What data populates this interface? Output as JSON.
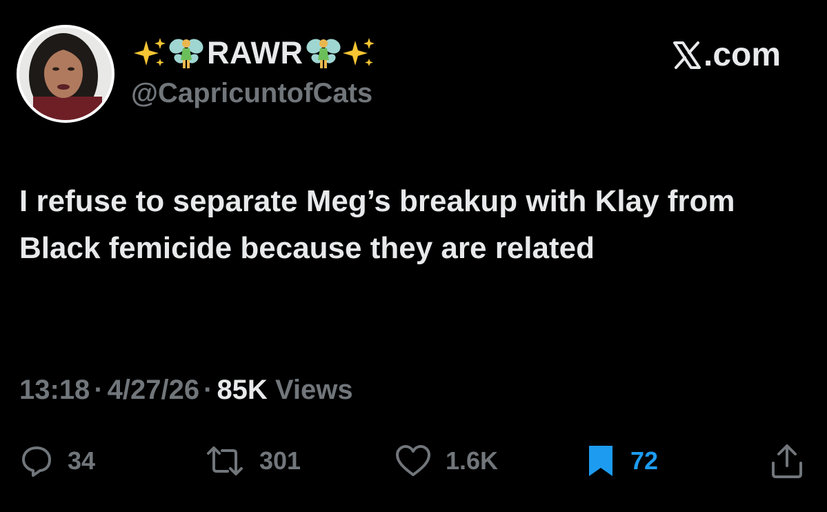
{
  "author": {
    "display_name": "RAWR",
    "handle": "@CapricuntofCats",
    "avatar_icon": "profile-photo",
    "name_emoji": [
      "sparkles-emoji",
      "fairy-emoji",
      "fairy-emoji",
      "sparkles-emoji"
    ]
  },
  "brand": {
    "label": ".com",
    "icon": "x-logo"
  },
  "tweet": {
    "text": "I refuse to separate Meg’s breakup with Klay from Black femicide because they are related"
  },
  "meta": {
    "time": "13:18",
    "separator": "·",
    "date": "4/27/26",
    "views_count": "85K",
    "views_label": "Views"
  },
  "actions": {
    "replies": "34",
    "reposts": "301",
    "likes": "1.6K",
    "bookmarks": "72"
  },
  "colors": {
    "background": "#000000",
    "text": "#e7e9ea",
    "muted": "#71767b",
    "accent": "#1d9bf0"
  }
}
